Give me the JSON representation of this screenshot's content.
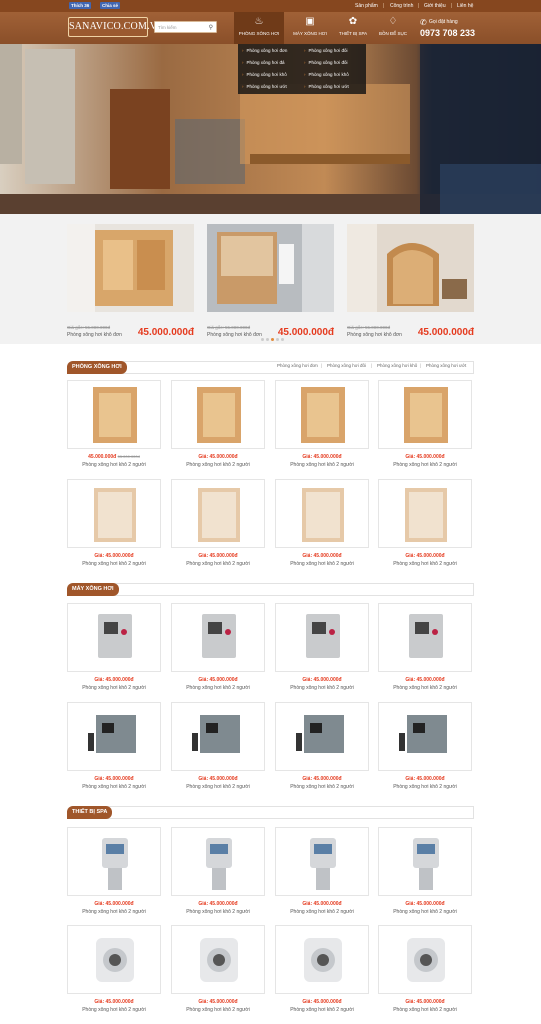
{
  "topbar": {
    "like_label": "Thích",
    "like_count": "36",
    "share_label": "Chia sẻ",
    "links": [
      "Sản phẩm",
      "Công trình",
      "Giới thiệu",
      "Liên hệ"
    ]
  },
  "header": {
    "logo": "SANAVICO.COM.VN",
    "search_placeholder": "Tìm kiếm",
    "nav": [
      {
        "label": "PHÒNG XÔNG HƠI",
        "icon": "sauna-icon"
      },
      {
        "label": "MÁY XÔNG HƠI",
        "icon": "steam-machine-icon"
      },
      {
        "label": "THIẾT BỊ SPA",
        "icon": "spa-icon"
      },
      {
        "label": "BỒN ĐỂ SỤC",
        "icon": "bathtub-icon"
      }
    ],
    "hotline_label": "Gọi đặt hàng",
    "hotline_number": "0973 708 233"
  },
  "dropdown": [
    "Phòng xông hơi đơn",
    "Phòng xông hơi đôi",
    "Phòng xông hơi đá",
    "Phòng xông hơi đôi",
    "Phòng xông hơi khô",
    "Phòng xông hơi khô",
    "Phòng xông hơi ướt",
    "Phòng xông hơi ướt"
  ],
  "slider": [
    {
      "old": "Giá gốc: 55.000.000đ",
      "name": "Phòng xông hơi khô đơn",
      "price": "45.000.000đ"
    },
    {
      "old": "Giá gốc: 55.000.000đ",
      "name": "Phòng xông hơi khô đơn",
      "price": "45.000.000đ"
    },
    {
      "old": "Giá gốc: 55.000.000đ",
      "name": "Phòng xông hơi khô đơn",
      "price": "45.000.000đ"
    }
  ],
  "sections": [
    {
      "title": "PHÒNG XÔNG HƠI",
      "links": [
        "Phòng xông hơi đơn",
        "Phòng xông hơi đôi",
        "Phòng xông hơi khô",
        "Phòng xông hơi ướt"
      ]
    },
    {
      "title": "MÁY XÔNG HƠI"
    },
    {
      "title": "THIẾT BỊ SPA"
    }
  ],
  "first_card": {
    "price": "45.000.000đ",
    "old": "55.000.000đ",
    "name": "Phòng xông hơi khô 2 người"
  },
  "card": {
    "price": "Giá: 45.000.000đ",
    "name": "Phòng xông hơi khô 2 người"
  },
  "colors": {
    "brand": "#a0562a",
    "price": "#e53a1e",
    "accent": "#e28b3b"
  }
}
